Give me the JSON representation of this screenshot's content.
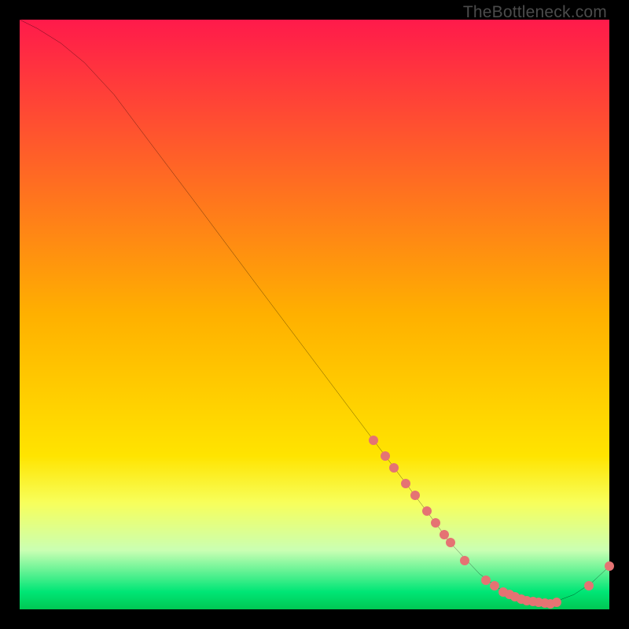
{
  "watermark": "TheBottleneck.com",
  "chart_data": {
    "type": "line",
    "title": "",
    "xlabel": "",
    "ylabel": "",
    "xlim": [
      0,
      100
    ],
    "ylim": [
      0,
      100
    ],
    "grid": false,
    "background": "vertical_gradient",
    "gradient_stops": [
      {
        "pos": 0,
        "color": "#ff1a4b"
      },
      {
        "pos": 0.5,
        "color": "#ffb000"
      },
      {
        "pos": 0.74,
        "color": "#ffe400"
      },
      {
        "pos": 0.82,
        "color": "#f7ff5c"
      },
      {
        "pos": 0.9,
        "color": "#caffb3"
      },
      {
        "pos": 0.97,
        "color": "#00e676"
      },
      {
        "pos": 1.0,
        "color": "#00c853"
      }
    ],
    "series": [
      {
        "name": "bottleneck-curve",
        "color": "#000000",
        "x": [
          0,
          3,
          7,
          11,
          16,
          22,
          30,
          40,
          50,
          60,
          68,
          73,
          78,
          82,
          86,
          90,
          94,
          97,
          100
        ],
        "y": [
          100,
          98.5,
          96,
          92.7,
          87.3,
          79.3,
          68.7,
          55.3,
          42,
          28.7,
          18,
          11.3,
          6,
          3,
          1.5,
          1,
          2.5,
          4.5,
          7.3
        ]
      }
    ],
    "markers": {
      "name": "highlight-points",
      "color": "#e57373",
      "points": [
        {
          "x": 60,
          "y": 28.7
        },
        {
          "x": 62,
          "y": 26.0
        },
        {
          "x": 63.5,
          "y": 24.0
        },
        {
          "x": 65.5,
          "y": 21.3
        },
        {
          "x": 67,
          "y": 19.3
        },
        {
          "x": 69,
          "y": 16.7
        },
        {
          "x": 70.5,
          "y": 14.7
        },
        {
          "x": 72,
          "y": 12.7
        },
        {
          "x": 73,
          "y": 11.3
        },
        {
          "x": 75.5,
          "y": 8.3
        },
        {
          "x": 79,
          "y": 5.0
        },
        {
          "x": 80.5,
          "y": 4.0
        },
        {
          "x": 82,
          "y": 3.0
        },
        {
          "x": 83,
          "y": 2.5
        },
        {
          "x": 84,
          "y": 2.1
        },
        {
          "x": 85,
          "y": 1.8
        },
        {
          "x": 86,
          "y": 1.5
        },
        {
          "x": 87,
          "y": 1.3
        },
        {
          "x": 88,
          "y": 1.2
        },
        {
          "x": 89,
          "y": 1.1
        },
        {
          "x": 90,
          "y": 1.0
        },
        {
          "x": 91,
          "y": 1.2
        },
        {
          "x": 96.5,
          "y": 4.0
        },
        {
          "x": 100,
          "y": 7.3
        }
      ]
    }
  }
}
